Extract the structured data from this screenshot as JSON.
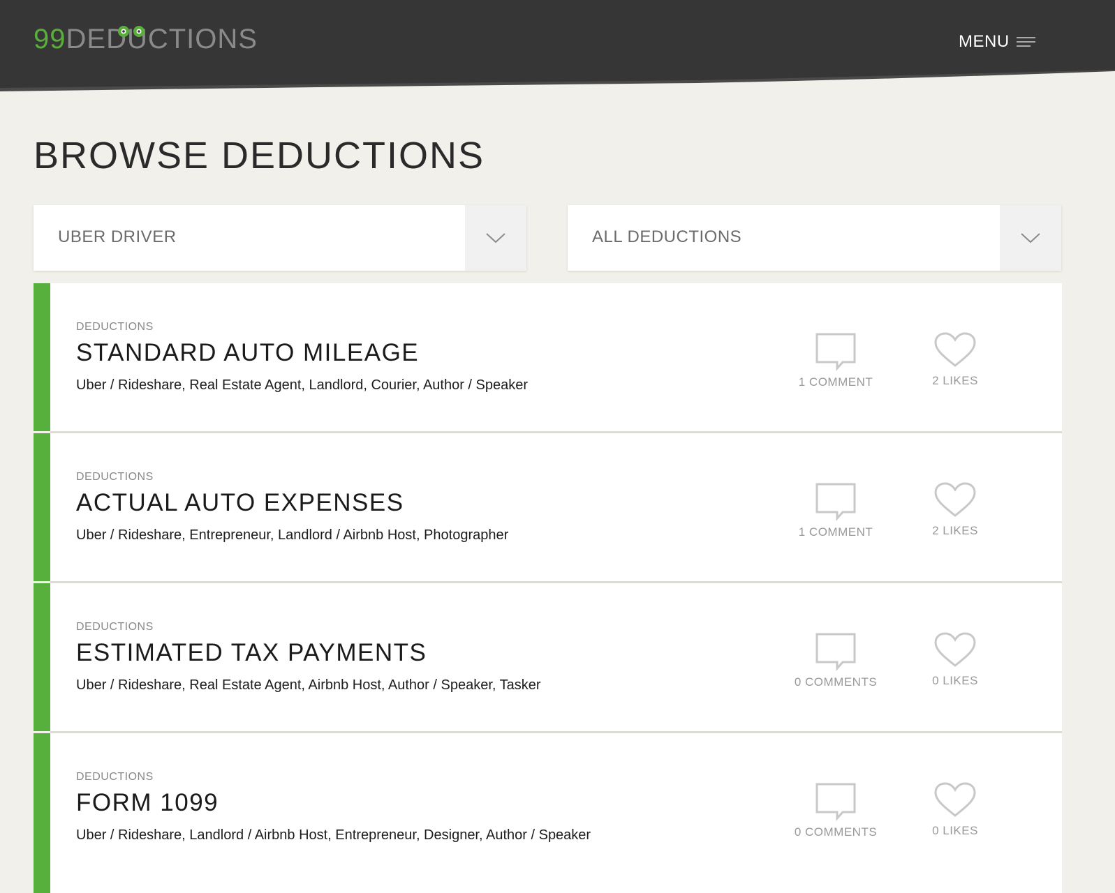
{
  "header": {
    "logo_number": "99",
    "logo_word": "DEDUCTIONS",
    "menu_label": "MENU"
  },
  "page_title": "BROWSE DEDUCTIONS",
  "filters": {
    "profession": "UBER DRIVER",
    "category": "ALL DEDUCTIONS"
  },
  "colors": {
    "header_bg": "#363636",
    "accent_green": "#58b03c",
    "page_bg": "#f1f0ea"
  },
  "deductions": [
    {
      "category": "DEDUCTIONS",
      "title": "STANDARD AUTO MILEAGE",
      "tags": "Uber / Rideshare, Real Estate Agent, Landlord, Courier, Author / Speaker",
      "comments": "1 COMMENT",
      "likes": "2 LIKES"
    },
    {
      "category": "DEDUCTIONS",
      "title": "ACTUAL AUTO EXPENSES",
      "tags": "Uber / Rideshare, Entrepreneur, Landlord / Airbnb Host, Photographer",
      "comments": "1 COMMENT",
      "likes": "2 LIKES"
    },
    {
      "category": "DEDUCTIONS",
      "title": "ESTIMATED TAX PAYMENTS",
      "tags": "Uber / Rideshare, Real Estate Agent, Airbnb Host, Author / Speaker, Tasker",
      "comments": "0 COMMENTS",
      "likes": "0 LIKES"
    },
    {
      "category": "DEDUCTIONS",
      "title": "FORM 1099",
      "tags": "Uber / Rideshare, Landlord / Airbnb Host, Entrepreneur, Designer, Author / Speaker",
      "comments": "0 COMMENTS",
      "likes": "0 LIKES"
    }
  ]
}
